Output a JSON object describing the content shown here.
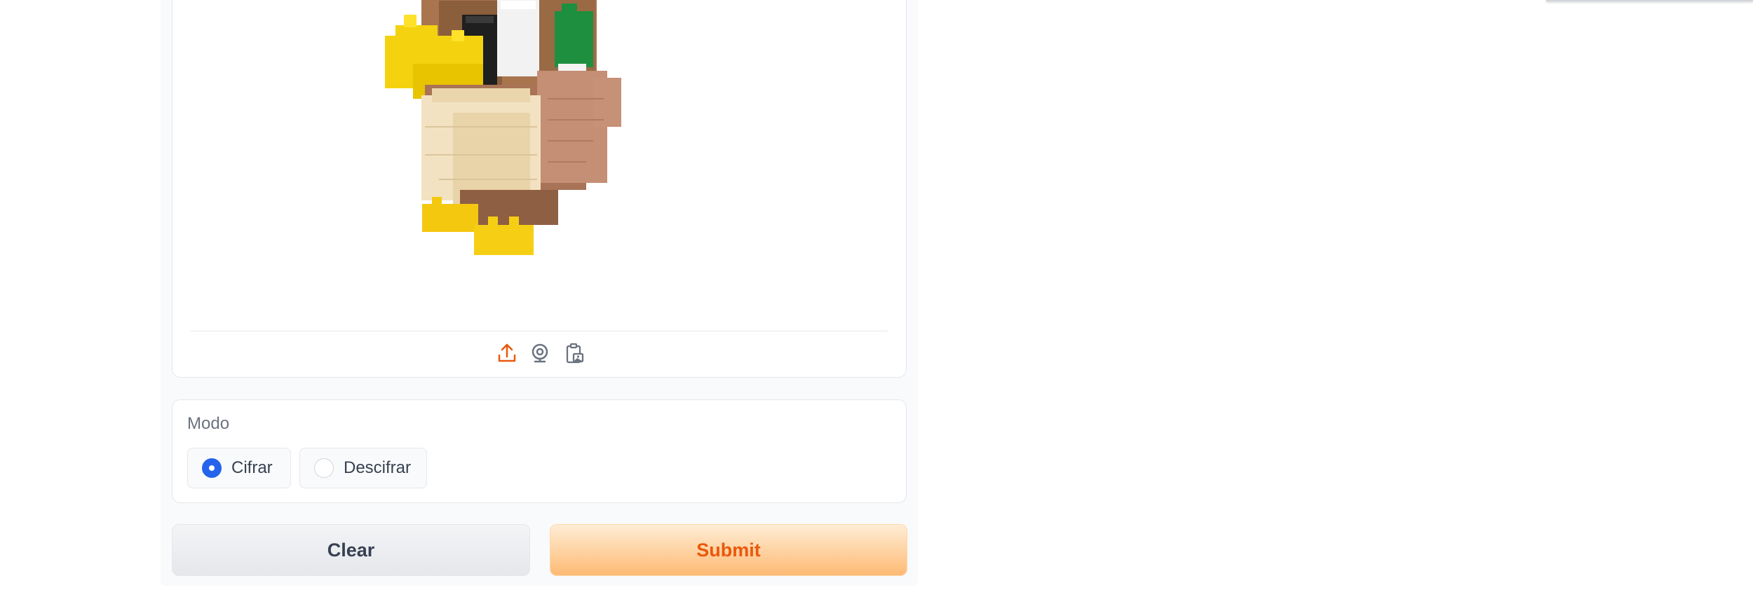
{
  "image_input": {
    "subject_icon": "lego-duck-image",
    "sources": [
      {
        "name": "upload-icon",
        "active": true
      },
      {
        "name": "webcam-icon",
        "active": false
      },
      {
        "name": "clipboard-icon",
        "active": false
      }
    ]
  },
  "mode": {
    "label": "Modo",
    "options": [
      "Cifrar",
      "Descifrar"
    ],
    "selected": "Cifrar"
  },
  "buttons": {
    "clear_label": "Clear",
    "submit_label": "Submit"
  },
  "colors": {
    "accent": "#ea580c",
    "radio_selected": "#2563eb",
    "border": "#e5e7eb"
  }
}
